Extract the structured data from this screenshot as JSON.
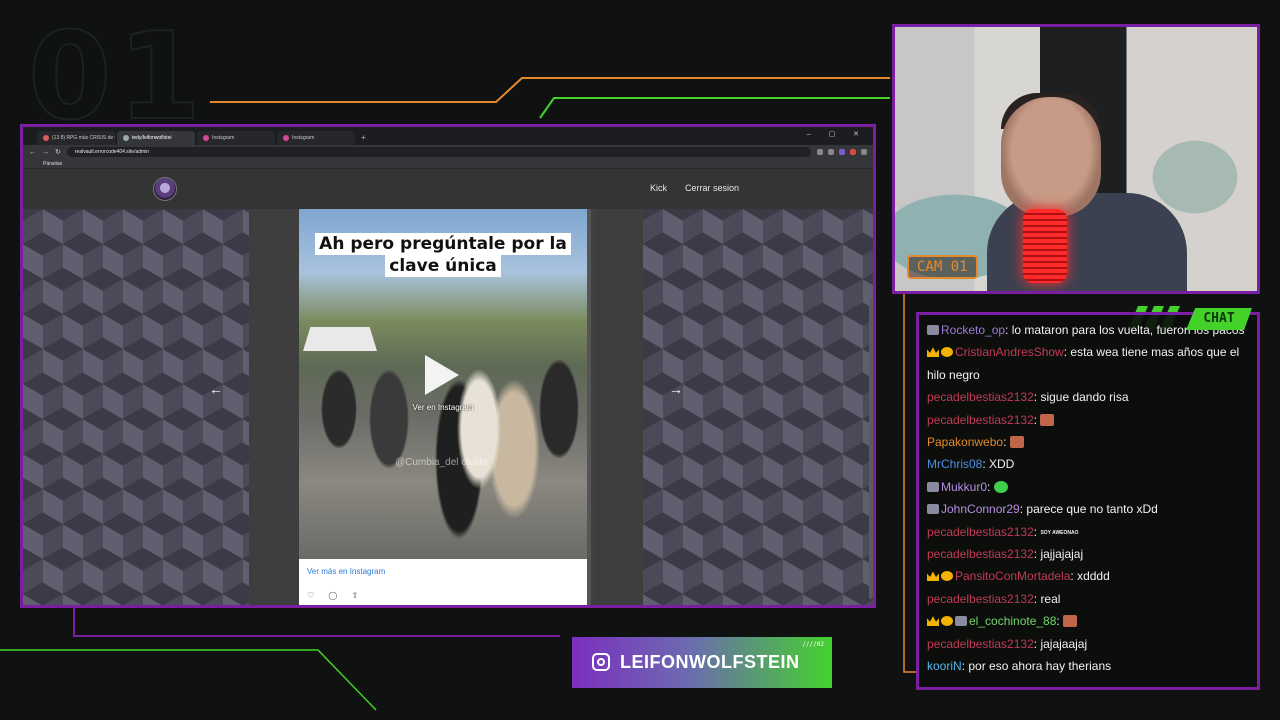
{
  "overlay": {
    "bg_number": "01",
    "accent_purple": "#7b1fa2",
    "accent_green": "#43d12a",
    "accent_orange": "#e58a2c"
  },
  "browser": {
    "tabs": [
      {
        "label": "(13 8) RPG más CRISIS de OS",
        "active": false
      },
      {
        "label": "tedy/leifonwolfstei",
        "active": true
      },
      {
        "label": "Instagram",
        "active": false
      },
      {
        "label": "Instagram",
        "active": false
      }
    ],
    "new_tab": "+",
    "window_controls": "– ▢ ✕",
    "url": "realvault.errorcode404.site/admin",
    "bookmark": "Pánsitas"
  },
  "site": {
    "nav": [
      "Kick",
      "Cerrar sesion"
    ]
  },
  "post": {
    "caption": "Ah pero pregúntale por la clave única",
    "play_label": "Ver en Instagram",
    "watermark": "@Cumbia_del olvido",
    "more_link": "Ver más en Instagram",
    "prev_arrow": "←",
    "next_arrow": "→",
    "icons": "♡ ◯ ⇧"
  },
  "cam": {
    "label": "CAM 01"
  },
  "chat": {
    "title": "CHAT",
    "messages": [
      {
        "user": "Rocketo_op",
        "color": "#9c7bd6",
        "badges": [
          "gift"
        ],
        "text": "lo mataron para los vuelta, fueron los pacos",
        "emote": ""
      },
      {
        "user": "CristianAndresShow",
        "color": "#c23a56",
        "badges": [
          "crown",
          "one"
        ],
        "text": "esta wea tiene mas años que el hilo negro",
        "emote": ""
      },
      {
        "user": "pecadelbestias2132",
        "color": "#c23a56",
        "badges": [],
        "text": "sigue dando risa",
        "emote": ""
      },
      {
        "user": "pecadelbestias2132",
        "color": "#c23a56",
        "badges": [],
        "text": "",
        "emote": "img"
      },
      {
        "user": "Papakonwebo",
        "color": "#e58a2c",
        "badges": [],
        "text": "",
        "emote": "img"
      },
      {
        "user": "MrChris08",
        "color": "#4e8fe0",
        "badges": [],
        "text": "XDD",
        "emote": ""
      },
      {
        "user": "Mukkur0",
        "color": "#b88de6",
        "badges": [
          "gift"
        ],
        "text": "",
        "emote": "green"
      },
      {
        "user": "JohnConnor29",
        "color": "#b88de6",
        "badges": [
          "gift"
        ],
        "text": "parece que no tanto xDd",
        "emote": ""
      },
      {
        "user": "pecadelbestias2132",
        "color": "#c23a56",
        "badges": [],
        "text": "",
        "emote": "SOY AWEONAO"
      },
      {
        "user": "pecadelbestias2132",
        "color": "#c23a56",
        "badges": [],
        "text": "jajjajajaj",
        "emote": ""
      },
      {
        "user": "PansitoConMortadela",
        "color": "#c23a56",
        "badges": [
          "crown",
          "one"
        ],
        "text": "xdddd",
        "emote": ""
      },
      {
        "user": "pecadelbestias2132",
        "color": "#c23a56",
        "badges": [],
        "text": "real",
        "emote": ""
      },
      {
        "user": "el_cochinote_88",
        "color": "#6fd86a",
        "badges": [
          "crown",
          "one",
          "gift"
        ],
        "text": "",
        "emote": "img"
      },
      {
        "user": "pecadelbestias2132",
        "color": "#c23a56",
        "badges": [],
        "text": "jajajaajaj",
        "emote": ""
      },
      {
        "user": "kooriN",
        "color": "#59b6e8",
        "badges": [],
        "text": "por eso ahora hay therians",
        "emote": ""
      }
    ]
  },
  "social": {
    "handle": "LEIFONWOLFSTEIN",
    "tag": "////02"
  }
}
